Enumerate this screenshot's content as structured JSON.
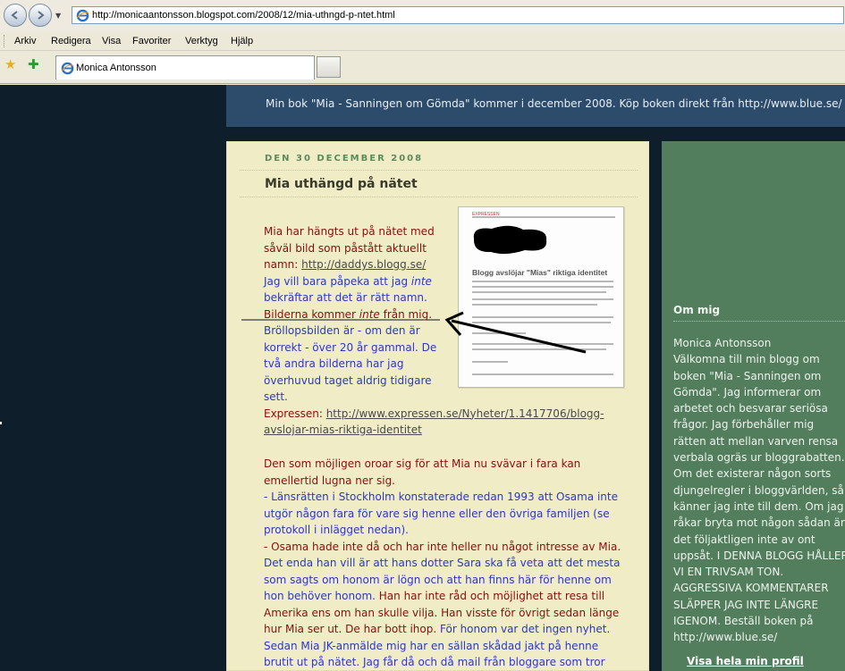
{
  "browser": {
    "url": "http://monicaantonsson.blogspot.com/2008/12/mia-uthngd-p-ntet.html",
    "menu": [
      "Arkiv",
      "Redigera",
      "Visa",
      "Favoriter",
      "Verktyg",
      "Hjälp"
    ],
    "tab_title": "Monica Antonsson"
  },
  "blog": {
    "header": "Min bok \"Mia - Sanningen om Gömda\" kommer i december 2008. Köp boken direkt från http://www.blue.se/"
  },
  "post": {
    "date": "DEN 30 DECEMBER 2008",
    "title": "Mia uthängd på nätet",
    "p1": {
      "l1": "Mia har hängts ut på nätet med",
      "l2": "såväl bild som påstått aktuellt",
      "l3_prefix": "namn: ",
      "l3_link": "http://daddys.blogg.se/",
      "l4_a": "Jag vill bara påpeka att jag ",
      "l4_i": "inte",
      "l5": "bekräftar att det är rätt namn.",
      "l6_a": "Bilderna kommer ",
      "l6_i": "inte",
      "l6_b": " från mig.",
      "l7": "Bröllopsbilden är - om den är",
      "l8": "korrekt - över 20 år gammal. De",
      "l9": "två andra bilderna har jag",
      "l10": "överhuvud taget aldrig tidigare",
      "l11": "sett.",
      "l12_prefix": "Expressen: ",
      "l12_link": "http://www.expressen.se/Nyheter/1.1417706/blogg-",
      "l13_link": "avslojar-mias-riktiga-identitet"
    },
    "p2": {
      "l1": "Den som möjligen oroar sig för att Mia nu svävar i fara kan",
      "l2": "emellertid lugna ner sig.",
      "l3": "- Länsrätten i Stockholm konstaterade redan 1993 att Osama inte",
      "l4": "utgör någon fara för vare sig henne eller den övriga familjen (se",
      "l5": "protokoll i inlägget nedan).",
      "l6": "- Osama hade inte då och har inte heller nu något intresse av Mia.",
      "l7": "Det enda han vill är att hans dotter Sara ska få veta att det mesta",
      "l8": "som sagts om honom är lögn och att han finns här för henne om",
      "l9_a": "hon behöver honom. ",
      "l9_b": "Han har inte råd och möjlighet att resa till",
      "l10": "Amerika ens om han skulle vilja. Han visste för övrigt sedan länge",
      "l11_a": "hur Mia ser ut. De har bott ihop. ",
      "l11_b": "För honom var det ingen nyhet.",
      "l12": "Sedan Mia JK-anmälde mig har en sällan skådad jakt på henne",
      "l13": "brutit ut på nätet. Jag får då och då mail från bloggare som tror"
    },
    "newspaper": {
      "kicker": "EXPRESSEN",
      "headline": "Blogg avslöjar \"Mias\" riktiga identitet"
    }
  },
  "sidebar": {
    "title": "Om mig",
    "lines": [
      "Monica Antonsson",
      "Välkomna till min blogg om",
      "boken \"Mia - Sanningen om",
      "Gömda\". Jag informerar om",
      "arbetet och besvarar seriösa",
      "frågor. Jag förbehåller mig",
      "rätten att mellan varven rensa",
      "verbala ogräs ur bloggrabatten.",
      "Om det existerar någon sorts",
      "djungelregler i bloggvärlden, så",
      "känner jag inte till dem. Om jag",
      "råkar bryta mot någon sådan är",
      "det följaktligen inte av ont",
      "uppsåt. I DENNA BLOGG HÅLLER",
      "VI EN TRIVSAM TON.",
      "AGGRESSIVA KOMMENTARER",
      "SLÄPPER JAG INTE LÄNGRE",
      "IGENOM. Beställ boken på",
      "http://www.blue.se/"
    ],
    "profile_link": "Visa hela min profil"
  }
}
